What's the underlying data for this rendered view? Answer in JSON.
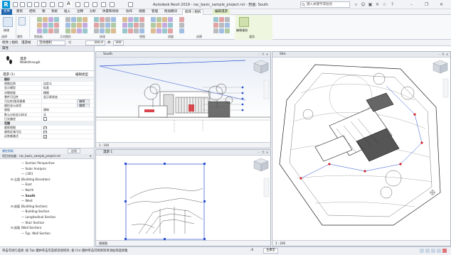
{
  "app": {
    "title": "Autodesk Revit 2019 - rac_basic_sample_project.rvt - 剖面: South",
    "logo_letter": "R",
    "search_placeholder": "键入关键字或短语"
  },
  "ribbon": {
    "tabs": [
      "文件",
      "建筑",
      "结构",
      "钢",
      "系统",
      "插入",
      "注释",
      "分析",
      "体量和场地",
      "协作",
      "视图",
      "管理",
      "附加模块",
      "修改 | 相机",
      "编辑漫游"
    ],
    "active_tab": "修改 | 相机",
    "context_tab": "编辑漫游",
    "panels": [
      "选择",
      "属性",
      "剪贴板",
      "几何图形",
      "修改",
      "视图",
      "测量",
      "创建",
      "漫游"
    ]
  },
  "options_bar": {
    "label1": "修改 | 相机",
    "label2": "漫游帧",
    "frame_value": "活动相机",
    "frame_label": "帧",
    "frame_number": "300.0",
    "total_label": "共",
    "total_frames": "300"
  },
  "properties": {
    "header": "属性",
    "type_name": "漫游",
    "type_sub": "Walkthrough",
    "instance_label": "漫游 (1)",
    "edit_type": "编辑类型",
    "rows": [
      {
        "k": "图形",
        "v": "",
        "group": true
      },
      {
        "k": "视图比例",
        "v": "自定义"
      },
      {
        "k": "显示模型",
        "v": "标准"
      },
      {
        "k": "详细程度",
        "v": "精细"
      },
      {
        "k": "零件可见性",
        "v": "显示原状态"
      },
      {
        "k": "可见性/图形替换",
        "v": "编辑..."
      },
      {
        "k": "图形显示选项",
        "v": "编辑..."
      },
      {
        "k": "规程",
        "v": "建筑"
      },
      {
        "k": "默认分析显示样式",
        "v": "无"
      },
      {
        "k": "日光路径",
        "v": "chk-off"
      },
      {
        "k": "范围",
        "v": "",
        "group": true
      },
      {
        "k": "裁剪视图",
        "v": "chk-on"
      },
      {
        "k": "裁剪区域可见",
        "v": "chk-on"
      },
      {
        "k": "远剪裁激活",
        "v": "chk-on"
      }
    ],
    "help_link": "属性帮助",
    "apply": "应用"
  },
  "browser": {
    "header": "项目浏览器 - rac_basic_sample_project.rvt",
    "nodes": [
      {
        "label": "Section Perspective",
        "indent": 6,
        "sel": false
      },
      {
        "label": "Solar Analysis",
        "indent": 6,
        "sel": false
      },
      {
        "label": "{3D}",
        "indent": 6,
        "sel": false
      },
      {
        "label": "⊟ 立面 (Building Elevation)",
        "indent": 3,
        "sel": false
      },
      {
        "label": "East",
        "indent": 6,
        "sel": false
      },
      {
        "label": "North",
        "indent": 6,
        "sel": false
      },
      {
        "label": "South",
        "indent": 6,
        "sel": true
      },
      {
        "label": "West",
        "indent": 6,
        "sel": false
      },
      {
        "label": "⊟ 剖面 (Building Section)",
        "indent": 3,
        "sel": false
      },
      {
        "label": "Building Section",
        "indent": 6,
        "sel": false
      },
      {
        "label": "Longitudinal Section",
        "indent": 6,
        "sel": false
      },
      {
        "label": "Stair Section",
        "indent": 6,
        "sel": false
      },
      {
        "label": "⊟ 剖面 (Wall Section)",
        "indent": 3,
        "sel": false
      },
      {
        "label": "Typ. Wall Section",
        "indent": 6,
        "sel": false
      }
    ]
  },
  "views": {
    "south": {
      "title": "South",
      "scale": "1 : 100"
    },
    "site": {
      "title": "Site",
      "scale": "1 : 200"
    },
    "walk": {
      "title": "漫游 1",
      "scale": "透视图"
    }
  },
  "status": {
    "text": "单击可进行选择; 按 Tab 键并单击可选择其他项目; 按 Ctrl 键并单击可将新项目添加到选择集",
    "model_label": "主模型",
    "zero": ":0"
  },
  "colors": {
    "accent": "#0696d7",
    "file_tab": "#2067b0",
    "context_green": "#e2f0c8",
    "crop_blue": "#2a4fd1",
    "section_red": "#d1232a"
  }
}
